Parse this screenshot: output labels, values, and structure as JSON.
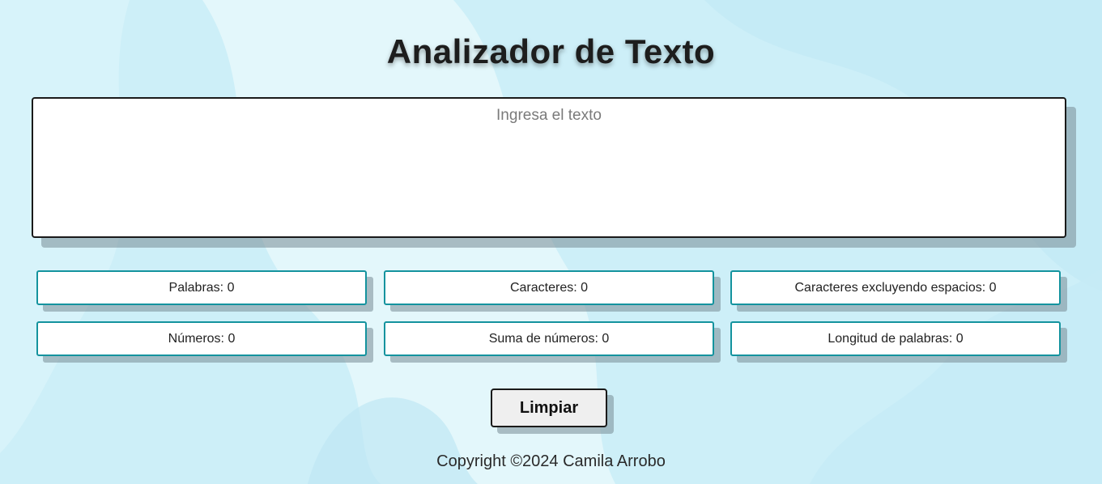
{
  "header": {
    "title": "Analizador de Texto"
  },
  "input": {
    "placeholder": "Ingresa el texto",
    "value": ""
  },
  "stats": {
    "words": "Palabras: 0",
    "characters": "Caracteres: 0",
    "characters_no_spaces": "Caracteres excluyendo espacios: 0",
    "numbers": "Números: 0",
    "numbers_sum": "Suma de números: 0",
    "word_length": "Longitud de palabras: 0"
  },
  "actions": {
    "clear_label": "Limpiar"
  },
  "footer": {
    "copyright": "Copyright ©2024 Camila Arrobo"
  },
  "colors": {
    "background": "#cdeff8",
    "stat_border": "#14939e",
    "text_dark": "#1d1d1d"
  }
}
